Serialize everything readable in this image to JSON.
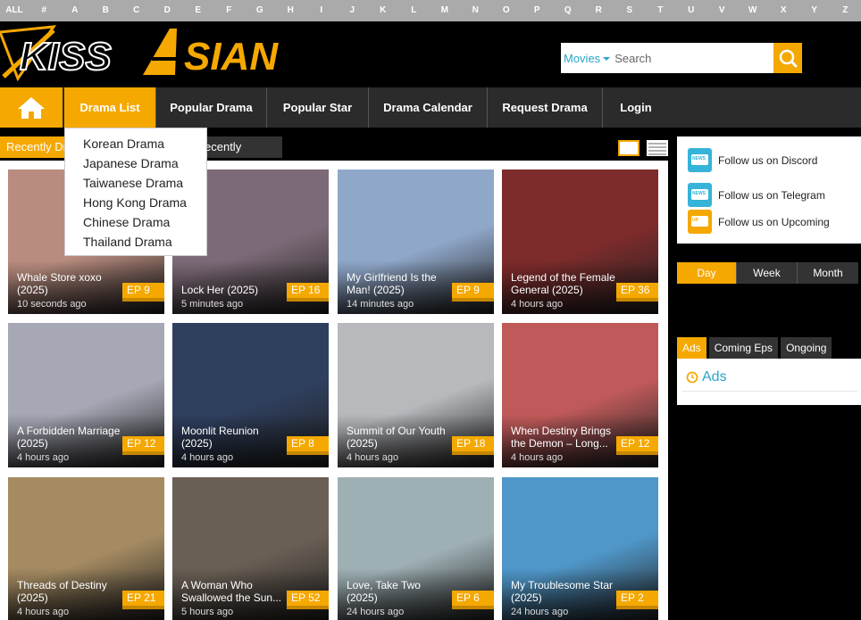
{
  "alphabet": [
    "ALL",
    "#",
    "A",
    "B",
    "C",
    "D",
    "E",
    "F",
    "G",
    "H",
    "I",
    "J",
    "K",
    "L",
    "M",
    "N",
    "O",
    "P",
    "Q",
    "R",
    "S",
    "T",
    "U",
    "V",
    "W",
    "X",
    "Y",
    "Z"
  ],
  "logo": {
    "text_left": "KISS",
    "text_right": "SIAN",
    "brand_color": "#f5a800"
  },
  "search": {
    "category": "Movies",
    "placeholder": "Search"
  },
  "nav": {
    "items": [
      "Drama List",
      "Popular Drama",
      "Popular Star",
      "Drama Calendar",
      "Request Drama",
      "Login"
    ],
    "active": "Drama List"
  },
  "dropdown": [
    "Korean Drama",
    "Japanese Drama",
    "Taiwanese Drama",
    "Hong Kong Drama",
    "Chinese Drama",
    "Thailand Drama"
  ],
  "subtabs": {
    "recent_drama": "Recently Dr",
    "recent_kshow": "ecently Kshow"
  },
  "cards": [
    {
      "title": "Whale Store xoxo (2025)",
      "ep": "EP 9",
      "time": "10 seconds ago",
      "color": "#b98c7f"
    },
    {
      "title": "Lock Her (2025)",
      "ep": "EP 16",
      "time": "5 minutes ago",
      "color": "#7d6a78"
    },
    {
      "title": "My Girlfriend Is the Man! (2025)",
      "ep": "EP 9",
      "time": "14 minutes ago",
      "color": "#8fa7c9"
    },
    {
      "title": "Legend of the Female General (2025)",
      "ep": "EP 36",
      "time": "4 hours ago",
      "color": "#7d2b2b"
    },
    {
      "title": "A Forbidden Marriage (2025)",
      "ep": "EP 12",
      "time": "4 hours ago",
      "color": "#a6a8b5"
    },
    {
      "title": "Moonlit Reunion (2025)",
      "ep": "EP 8",
      "time": "4 hours ago",
      "color": "#2f3f5e"
    },
    {
      "title": "Summit of Our Youth (2025)",
      "ep": "EP 18",
      "time": "4 hours ago",
      "color": "#b7b9bd"
    },
    {
      "title": "When Destiny Brings the Demon – Long...",
      "ep": "EP 12",
      "time": "4 hours ago",
      "color": "#c05a5a"
    },
    {
      "title": "Threads of Destiny (2025)",
      "ep": "EP 21",
      "time": "4 hours ago",
      "color": "#a58b62"
    },
    {
      "title": "A Woman Who Swallowed the Sun...",
      "ep": "EP 52",
      "time": "5 hours ago",
      "color": "#6a5f55"
    },
    {
      "title": "Love, Take Two (2025)",
      "ep": "EP 6",
      "time": "24 hours ago",
      "color": "#9fb0b5"
    },
    {
      "title": "My Troublesome Star (2025)",
      "ep": "EP 2",
      "time": "24 hours ago",
      "color": "#4f97c9"
    }
  ],
  "sidebar": {
    "social": [
      {
        "label": "Follow us on Discord",
        "icon": "news-icon",
        "badge": "NEWS"
      },
      {
        "label": "Follow us on Telegram",
        "icon": "news-icon",
        "badge": "NEWS"
      },
      {
        "label": "Follow us on Upcoming",
        "icon": "upcoming-icon",
        "badge": "UP"
      }
    ],
    "period_tabs": [
      "Day",
      "Week",
      "Month"
    ],
    "list_tabs": [
      "Ads",
      "Coming Eps",
      "Ongoing"
    ],
    "ads_title": "Ads"
  }
}
